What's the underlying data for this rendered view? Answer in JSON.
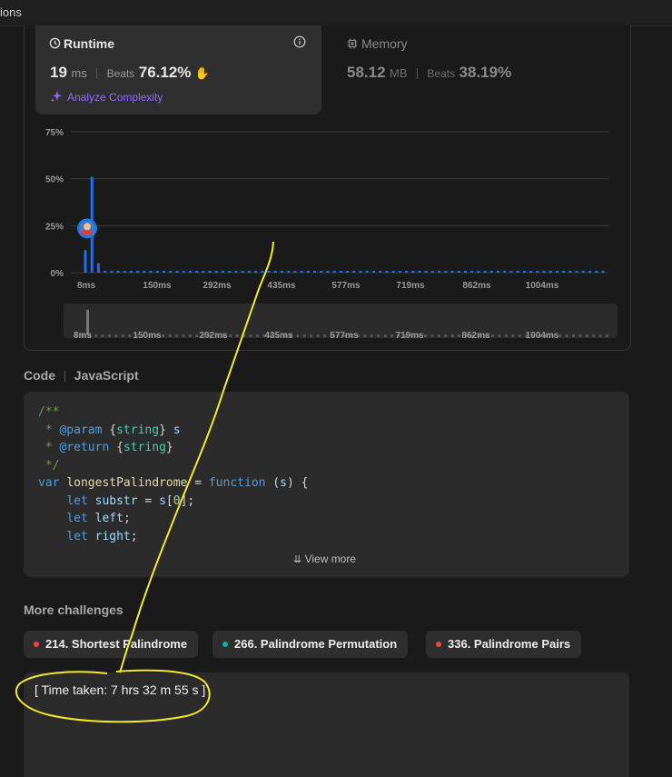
{
  "topbar": {
    "tab_fragment": "ions"
  },
  "runtime": {
    "title": "Runtime",
    "value": "19",
    "unit": "ms",
    "beats_label": "Beats",
    "beats_pct": "76.12%",
    "analyze": "Analyze Complexity",
    "icon": "clock-icon",
    "info_icon": "info-icon",
    "clap_icon": "clap-emoji"
  },
  "memory": {
    "title": "Memory",
    "value": "58.12",
    "unit": "MB",
    "beats_label": "Beats",
    "beats_pct": "38.19%",
    "icon": "chip-icon"
  },
  "chart_data": {
    "type": "bar",
    "y_ticks": [
      "75%",
      "50%",
      "25%",
      "0%"
    ],
    "ylim": [
      0,
      75
    ],
    "x_ticks": [
      "8ms",
      "150ms",
      "292ms",
      "435ms",
      "577ms",
      "719ms",
      "862ms",
      "1004ms"
    ],
    "values": [
      12,
      51,
      5,
      1,
      1,
      1,
      1,
      1,
      1,
      1,
      1,
      1,
      1,
      1,
      1,
      1,
      1,
      1,
      1,
      1,
      1,
      1,
      1,
      1,
      1,
      1,
      1,
      1,
      1,
      1,
      1,
      1,
      1,
      1,
      1,
      1,
      1,
      1,
      1,
      1,
      1,
      1,
      1,
      1,
      1,
      1,
      1,
      1,
      1,
      1,
      1,
      1,
      1,
      1,
      1,
      1,
      1,
      1,
      1,
      1,
      1,
      1,
      1,
      1,
      1,
      1,
      1,
      1,
      1,
      1,
      1,
      1,
      1,
      1,
      1,
      1,
      1,
      1,
      1,
      1
    ],
    "user_marker_y": 25,
    "grid": true,
    "bar_color": "#1a73e8"
  },
  "code": {
    "header_label": "Code",
    "language": "JavaScript",
    "view_more": "View more"
  },
  "challenges": {
    "title": "More challenges",
    "items": [
      {
        "label": "214. Shortest Palindrome",
        "color": "#ef4743"
      },
      {
        "label": "266. Palindrome Permutation",
        "color": "#00b8a3"
      },
      {
        "label": "336. Palindrome Pairs",
        "color": "#ef4743"
      }
    ]
  },
  "notes": {
    "text": "[ Time taken: 7 hrs 32 m 55 s ]"
  }
}
